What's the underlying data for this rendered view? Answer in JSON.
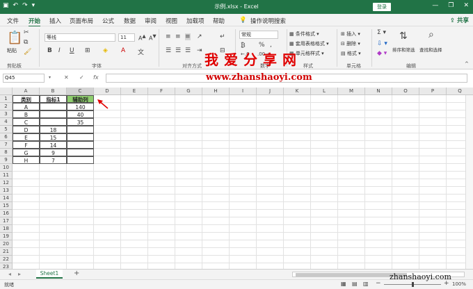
{
  "titlebar": {
    "title": "示例.xlsx  -  Excel",
    "login": "登录",
    "min": "—",
    "restore": "❐",
    "close": "✕",
    "qat_save": "▣",
    "qat_undo": "↶",
    "qat_redo": "↷",
    "qat_more": "▾"
  },
  "menu": {
    "tabs": [
      "文件",
      "开始",
      "插入",
      "页面布局",
      "公式",
      "数据",
      "审阅",
      "视图",
      "加载项",
      "帮助"
    ],
    "search": "操作说明搜索",
    "share": "共享"
  },
  "ribbon": {
    "clipboard": {
      "label": "剪贴板",
      "paste": "粘贴"
    },
    "font": {
      "label": "字体",
      "family": "等线",
      "size": "11",
      "bold": "B",
      "italic": "I",
      "underline": "U"
    },
    "align": {
      "label": "对齐方式"
    },
    "number": {
      "label": "数字",
      "format": "常规"
    },
    "styles": {
      "label": "样式",
      "cond": "条件格式",
      "table": "套用表格格式",
      "cell": "单元格样式"
    },
    "cells": {
      "label": "单元格",
      "insert": "插入",
      "delete": "删除",
      "format": "格式"
    },
    "edit": {
      "label": "编辑",
      "sort": "排序和筛选",
      "find": "查找和选择"
    }
  },
  "formula": {
    "namebox": "Q45",
    "fx": "fx",
    "cancel": "✕",
    "enter": "✓"
  },
  "watermark": {
    "url": "www.zhanshaoyi.com",
    "title": "我爱分享网",
    "bottom": "zhanshaoyi.com"
  },
  "sheet": {
    "columns": [
      "A",
      "B",
      "C",
      "D",
      "E",
      "F",
      "G",
      "H",
      "I",
      "J",
      "K",
      "L",
      "M",
      "N",
      "O",
      "P",
      "Q"
    ],
    "rows": [
      "1",
      "2",
      "3",
      "4",
      "5",
      "6",
      "7",
      "8",
      "9",
      "10",
      "11",
      "12",
      "13",
      "14",
      "15",
      "16",
      "17",
      "18",
      "19",
      "20",
      "21",
      "22",
      "23"
    ],
    "headers": [
      "类别",
      "指标1",
      "辅助列"
    ],
    "data": [
      [
        "A",
        "",
        "140"
      ],
      [
        "B",
        "",
        "40"
      ],
      [
        "C",
        "",
        "35"
      ],
      [
        "D",
        "18",
        ""
      ],
      [
        "E",
        "15",
        ""
      ],
      [
        "F",
        "14",
        ""
      ],
      [
        "G",
        "9",
        ""
      ],
      [
        "H",
        "7",
        ""
      ]
    ]
  },
  "sheettabs": {
    "active": "Sheet1",
    "add": "+"
  },
  "status": {
    "ready": "就绪",
    "zoom": "100%"
  },
  "colors": {
    "accent": "#217346",
    "helper": "#8fce6e",
    "arrow": "#e00000"
  }
}
